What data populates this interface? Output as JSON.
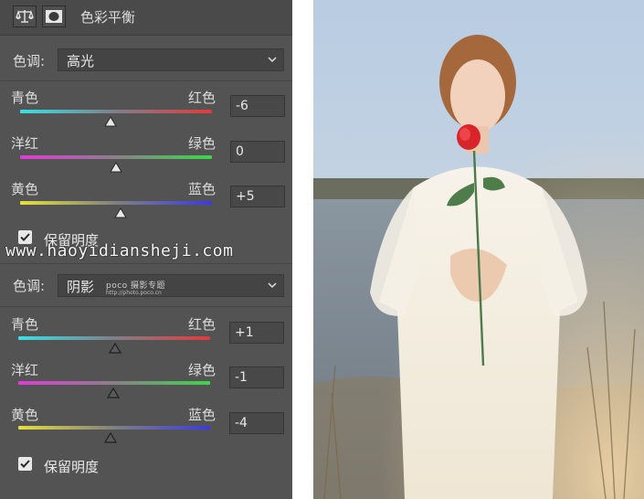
{
  "panel": {
    "title": "色彩平衡",
    "icons": [
      "scales-icon",
      "mask-icon"
    ]
  },
  "section1": {
    "tone_label": "色调:",
    "tone_value": "高光",
    "sliders": [
      {
        "left": "青色",
        "right": "红色",
        "value": "-6",
        "level": -6
      },
      {
        "left": "洋红",
        "right": "绿色",
        "value": "0",
        "level": 0
      },
      {
        "left": "黄色",
        "right": "蓝色",
        "value": "+5",
        "level": 5
      }
    ],
    "preserve_luminosity": "保留明度",
    "preserve_checked": true
  },
  "section2": {
    "tone_label": "色调:",
    "tone_value": "阴影",
    "sliders": [
      {
        "left": "青色",
        "right": "红色",
        "value": "+1",
        "level": 1
      },
      {
        "left": "洋红",
        "right": "绿色",
        "value": "-1",
        "level": -1
      },
      {
        "left": "黄色",
        "right": "蓝色",
        "value": "-4",
        "level": -4
      }
    ],
    "preserve_luminosity": "保留明度",
    "preserve_checked": true
  },
  "watermark": {
    "site": "www.haoyidiansheji.com",
    "poco_main": "poco 摄影专题",
    "poco_sub": "http://photo.poco.cn"
  },
  "colors": {
    "panel_bg": "#535353",
    "cyan": "#38e0e6",
    "red": "#e33a3a",
    "magenta": "#e33ad8",
    "green": "#3ad84a",
    "yellow": "#e6e03a",
    "blue": "#3a3ae6"
  }
}
